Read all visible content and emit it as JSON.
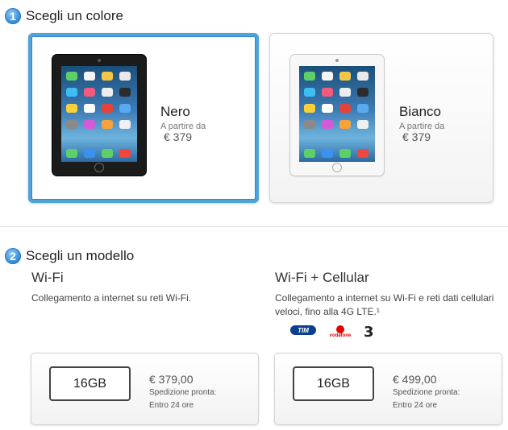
{
  "step1": {
    "number": "1",
    "title": "Scegli un colore"
  },
  "colors": [
    {
      "name": "Nero",
      "from": "A partire da",
      "price": "€ 379",
      "device": "ipad-black"
    },
    {
      "name": "Bianco",
      "from": "A partire da",
      "price": "€ 379",
      "device": "ipad-white"
    }
  ],
  "step2": {
    "number": "2",
    "title": "Scegli un modello"
  },
  "models": [
    {
      "title": "Wi-Fi",
      "description": "Collegamento a internet su reti Wi-Fi.",
      "option": {
        "capacity": "16GB",
        "price": "€ 379,00",
        "shipping": "Spedizione pronta:",
        "shipping_time": "Entro 24 ore"
      }
    },
    {
      "title": "Wi-Fi + Cellular",
      "description_line1": "Collegamento a internet su Wi-Fi e reti dati cellulari",
      "description_line2": "veloci, fino alla 4G LTE.¹",
      "carriers": {
        "tim": "TIM",
        "vodafone": "vodafone",
        "three": "3"
      },
      "option": {
        "capacity": "16GB",
        "price": "€ 499,00",
        "shipping": "Spedizione pronta:",
        "shipping_time": "Entro 24 ore"
      }
    }
  ],
  "colors_palette": {
    "accent": "#2d87c8",
    "selected_border": "#4ea3dd"
  }
}
